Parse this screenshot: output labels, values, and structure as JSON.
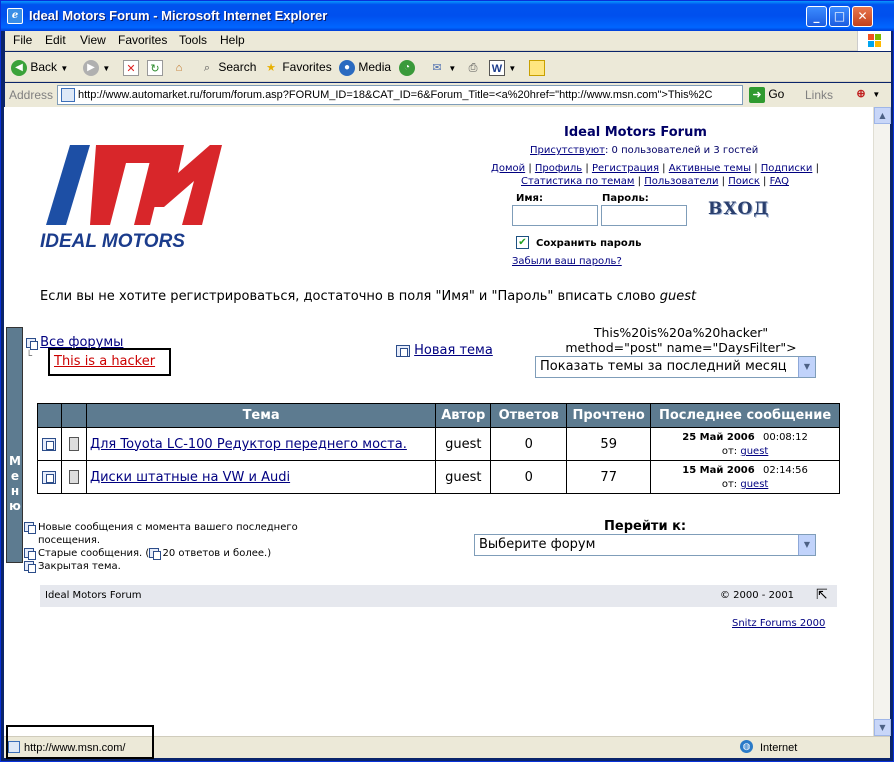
{
  "window": {
    "title": "Ideal Motors Forum - Microsoft Internet Explorer",
    "minimize_glyph": "_",
    "maximize_glyph": "□",
    "close_glyph": "✕"
  },
  "menubar": {
    "items": [
      {
        "label": "File"
      },
      {
        "label": "Edit"
      },
      {
        "label": "View"
      },
      {
        "label": "Favorites"
      },
      {
        "label": "Tools"
      },
      {
        "label": "Help"
      }
    ]
  },
  "toolbar": {
    "back_label": "Back",
    "search_label": "Search",
    "favorites_label": "Favorites",
    "media_label": "Media"
  },
  "addressbar": {
    "label": "Address",
    "url": "http://www.automarket.ru/forum/forum.asp?FORUM_ID=18&CAT_ID=6&Forum_Title=<a%20href=\"http://www.msn.com\">This%2C",
    "go_label": "Go",
    "links_label": "Links"
  },
  "forum": {
    "title": "Ideal Motors Forum",
    "logo_text": "IDEAL MOTORS",
    "present_label": "Присутствуют",
    "present_text": ": 0 пользователей и 3 гостей",
    "nav_links": [
      "Домой",
      "Профиль",
      "Регистрация",
      "Активные темы",
      "Подписки",
      "Статистика по темам",
      "Пользователи",
      "Поиск",
      "FAQ"
    ],
    "login": {
      "name_label": "Имя:",
      "password_label": "Пароль:",
      "name_value": "",
      "password_value": "",
      "enter_label": "ВХОД",
      "remember_label": "Сохранить пароль",
      "remember_checked": true,
      "forgot_label": "Забыли ваш пароль?"
    },
    "notice_text": "Если вы не хотите регистрироваться, достаточно в поля \"Имя\" и \"Пароль\" вписать слово ",
    "notice_word": "guest",
    "all_forums": "Все форумы",
    "hacker_link": "This is a hacker",
    "new_topic": "Новая тема",
    "filter_line1": "This%20is%20a%20hacker\"",
    "filter_line2": "method=\"post\" name=\"DaysFilter\">",
    "filter_select": "Показать темы за последний месяц",
    "table": {
      "headers": [
        "Тема",
        "Автор",
        "Ответов",
        "Прочтено",
        "Последнее сообщение"
      ],
      "rows": [
        {
          "topic": "Для Toyota LC-100 Редуктор переднего моста.",
          "author": "guest",
          "replies": "0",
          "views": "59",
          "last_date": "25 Май 2006",
          "last_time": "00:08:12",
          "from_label": "от: ",
          "last_user": "guest"
        },
        {
          "topic": "Диски штатные на VW и Audi",
          "author": "guest",
          "replies": "0",
          "views": "77",
          "last_date": "15 Май 2006",
          "last_time": "02:14:56",
          "from_label": "от: ",
          "last_user": "guest"
        }
      ]
    },
    "legend": {
      "new_posts": "Новые сообщения с момента вашего последнего посещения.",
      "old_posts": "Старые сообщения. (",
      "hot_posts": " 20 ответов и более.)",
      "closed": "Закрытая тема."
    },
    "goto_label": "Перейти к:",
    "goto_select": "Выберите форум",
    "footer_left": "Ideal Motors Forum",
    "footer_right": "© 2000 - 2001",
    "snitz": "Snitz Forums 2000",
    "menu_tab": "Меню"
  },
  "statusbar": {
    "url": "http://www.msn.com/",
    "zone": "Internet"
  }
}
